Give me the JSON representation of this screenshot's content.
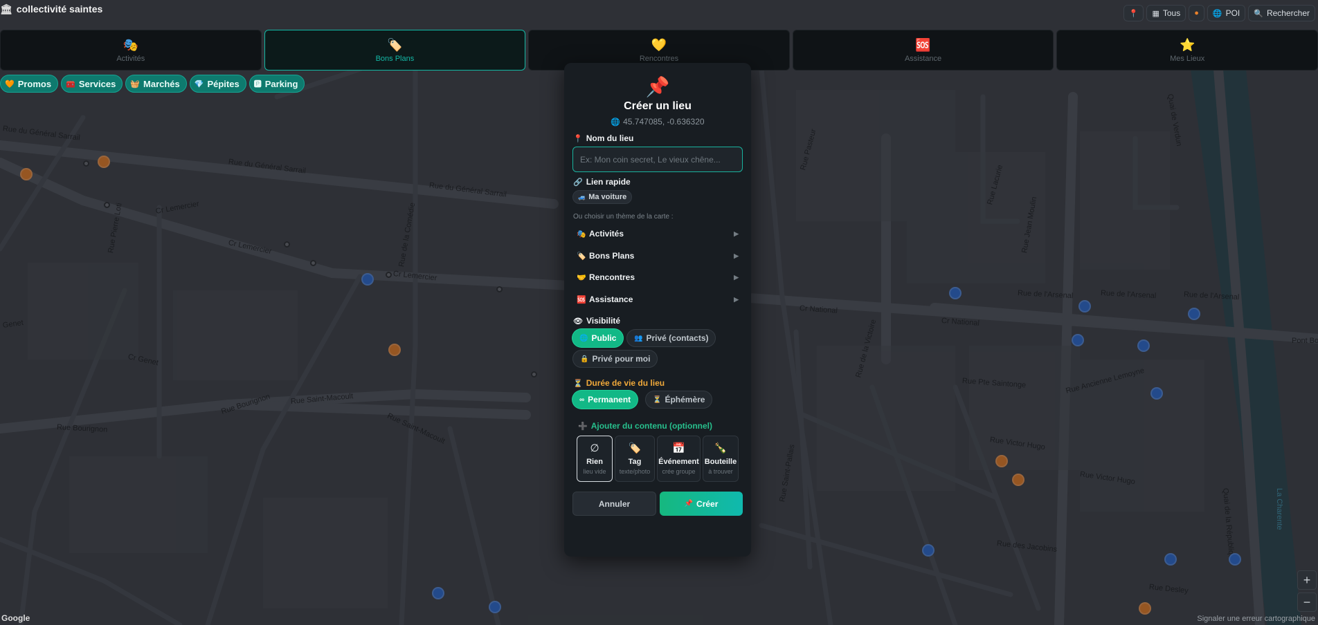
{
  "app": {
    "title": "collectivité saintes",
    "title_icon": "bank-icon"
  },
  "top_tools": [
    {
      "icon": "pin-icon",
      "label": ""
    },
    {
      "icon": "grid-icon",
      "label": "Tous"
    },
    {
      "icon": "dot-icon",
      "label": ""
    },
    {
      "icon": "globe-icon",
      "label": "POI"
    },
    {
      "icon": "search-icon",
      "label": "Rechercher"
    }
  ],
  "tabs": [
    {
      "icon": "🎭",
      "label": "Activités"
    },
    {
      "icon": "🏷️",
      "label": "Bons Plans",
      "active": true
    },
    {
      "icon": "💛",
      "label": "Rencontres"
    },
    {
      "icon": "🆘",
      "label": "Assistance"
    },
    {
      "icon": "⭐",
      "label": "Mes Lieux"
    }
  ],
  "chips": [
    {
      "icon": "🧡",
      "label": "Promos"
    },
    {
      "icon": "🧰",
      "label": "Services"
    },
    {
      "icon": "🧺",
      "label": "Marchés"
    },
    {
      "icon": "💎",
      "label": "Pépites"
    },
    {
      "icon": "🅿",
      "label": "Parking"
    }
  ],
  "modal": {
    "title": "Créer un lieu",
    "coords": "45.747085, -0.636320",
    "name_label": "Nom du lieu",
    "name_placeholder": "Ex: Mon coin secret, Le vieux chêne...",
    "name_value": "",
    "quick_link_label": "Lien rapide",
    "car_chip": "Ma voiture",
    "theme_hint": "Ou choisir un thème de la carte :",
    "themes": [
      {
        "icon": "🎭",
        "label": "Activités"
      },
      {
        "icon": "🏷️",
        "label": "Bons Plans"
      },
      {
        "icon": "🤝",
        "label": "Rencontres"
      },
      {
        "icon": "🆘",
        "label": "Assistance"
      }
    ],
    "visibility_label": "Visibilité",
    "visibility_options": [
      {
        "icon": "🌐",
        "label": "Public",
        "selected": true
      },
      {
        "icon": "👥",
        "label": "Privé (contacts)",
        "selected": false
      },
      {
        "icon": "🔒",
        "label": "Privé pour moi",
        "selected": false
      }
    ],
    "lifetime_label": "Durée de vie du lieu",
    "lifetime_options": [
      {
        "icon": "∞",
        "label": "Permanent",
        "selected": true
      },
      {
        "icon": "⏳",
        "label": "Éphémère",
        "selected": false
      }
    ],
    "content_label": "Ajouter du contenu (optionnel)",
    "content_options": [
      {
        "icon": "∅",
        "title": "Rien",
        "sub": "lieu vide",
        "selected": true
      },
      {
        "icon": "🏷️",
        "title": "Tag",
        "sub": "texte/photo",
        "selected": false
      },
      {
        "icon": "📅",
        "title": "Événement",
        "sub": "crée groupe",
        "selected": false
      },
      {
        "icon": "🍾",
        "title": "Bouteille",
        "sub": "à trouver",
        "selected": false
      }
    ],
    "cancel": "Annuler",
    "create": "Créer"
  },
  "map": {
    "streets": [
      "Rue du Général Sarrail",
      "Rue du Général Sarrail",
      "Rue du Général Sarrail",
      "Cr Lemercier",
      "Cr Lemercier",
      "Cr Lemercier",
      "Rue Saint-Macoult",
      "Rue Saint-Macoult",
      "Rue Bourignon",
      "Rue Bourignon",
      "Cr Genet",
      "Genet",
      "Rue Pierre Loti",
      "Rue de la Comédie",
      "Cr National",
      "Cr National",
      "Rue Pasteur",
      "Rue de l'Arsenal",
      "Rue de l'Arsenal",
      "Rue de l'Arsenal",
      "Rue Victor Hugo",
      "Rue Victor Hugo",
      "Rue Pte Saintonge",
      "Rue Ancienne Lemoyne",
      "Rue Saint-Pallais",
      "Rue des Jacobins",
      "Rue Desley",
      "Rue Lacurie",
      "Rue Jean Moulin",
      "Quai de la République",
      "Quai de Verdun",
      "La Charente",
      "Pont Bo",
      "Rue de la Victoire"
    ],
    "attribution": "Signaler une erreur cartographique",
    "provider": "Google"
  },
  "colors": {
    "accent": "#14b8a6",
    "create": "#16b87f",
    "modal_bg": "#181d22"
  }
}
